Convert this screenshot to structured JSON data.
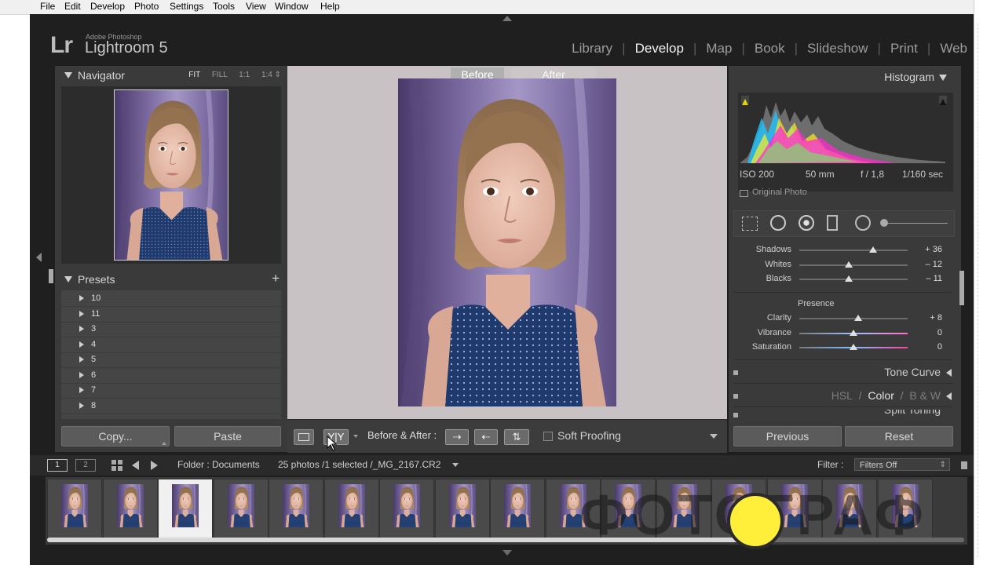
{
  "os_menu": [
    "File",
    "Edit",
    "Develop",
    "Photo",
    "Settings",
    "Tools",
    "View",
    "Window",
    "Help"
  ],
  "identity": {
    "logo": "Lr",
    "vendor": "Adobe Photoshop",
    "product": "Lightroom 5"
  },
  "modules": [
    {
      "label": "Library",
      "active": false
    },
    {
      "label": "Develop",
      "active": true
    },
    {
      "label": "Map",
      "active": false
    },
    {
      "label": "Book",
      "active": false
    },
    {
      "label": "Slideshow",
      "active": false
    },
    {
      "label": "Print",
      "active": false
    },
    {
      "label": "Web",
      "active": false
    }
  ],
  "navigator": {
    "title": "Navigator",
    "zoom_options": [
      "FIT",
      "FILL",
      "1:1",
      "1:4 ⇕"
    ],
    "active_zoom": "FIT"
  },
  "presets": {
    "title": "Presets",
    "add_icon": "+",
    "items": [
      "10",
      "11",
      "3",
      "4",
      "5",
      "6",
      "7",
      "8"
    ]
  },
  "left_buttons": {
    "copy": "Copy...",
    "paste": "Paste"
  },
  "center": {
    "before_label": "Before",
    "after_label": "After"
  },
  "toolbar": {
    "view_yy": "Y|Y",
    "before_after_label": "Before & After :",
    "ba_buttons": [
      "⇢",
      "⇠",
      "⇅"
    ],
    "soft_proofing": "Soft Proofing"
  },
  "histogram": {
    "title": "Histogram",
    "iso": "ISO 200",
    "focal": "50 mm",
    "aperture": "f / 1,8",
    "shutter": "1/160 sec",
    "original_photo": "Original Photo"
  },
  "basic_sliders": [
    {
      "label": "Shadows",
      "value": "+ 36",
      "pos": 0.68
    },
    {
      "label": "Whites",
      "value": "– 12",
      "pos": 0.46
    },
    {
      "label": "Blacks",
      "value": "– 11",
      "pos": 0.46
    }
  ],
  "presence": {
    "title": "Presence",
    "sliders": [
      {
        "label": "Clarity",
        "value": "+ 8",
        "pos": 0.54
      },
      {
        "label": "Vibrance",
        "value": "0",
        "pos": 0.5
      },
      {
        "label": "Saturation",
        "value": "0",
        "pos": 0.5
      }
    ]
  },
  "sections": {
    "tone_curve": "Tone Curve",
    "hsl": "HSL",
    "hsl_sep1": "/",
    "color": "Color",
    "hsl_sep2": "/",
    "bw": "B & W",
    "split_toning": "Split Toning"
  },
  "right_buttons": {
    "previous": "Previous",
    "reset": "Reset"
  },
  "filmstrip_bar": {
    "screen1": "1",
    "screen2": "2",
    "folder": "Folder : Documents",
    "count": "25 photos /1 selected /_MG_2167.CR2",
    "filter_label": "Filter :",
    "filter_value": "Filters Off"
  },
  "filmstrip": {
    "count": 16,
    "selected_index": 2
  },
  "watermark": "ФОТОГРАФ",
  "colors": {
    "lr_bg": "#1f1f1f",
    "panel": "#3a3a3a",
    "center_bg": "#c8c2c4",
    "accent_circle": "#ffef3b"
  }
}
